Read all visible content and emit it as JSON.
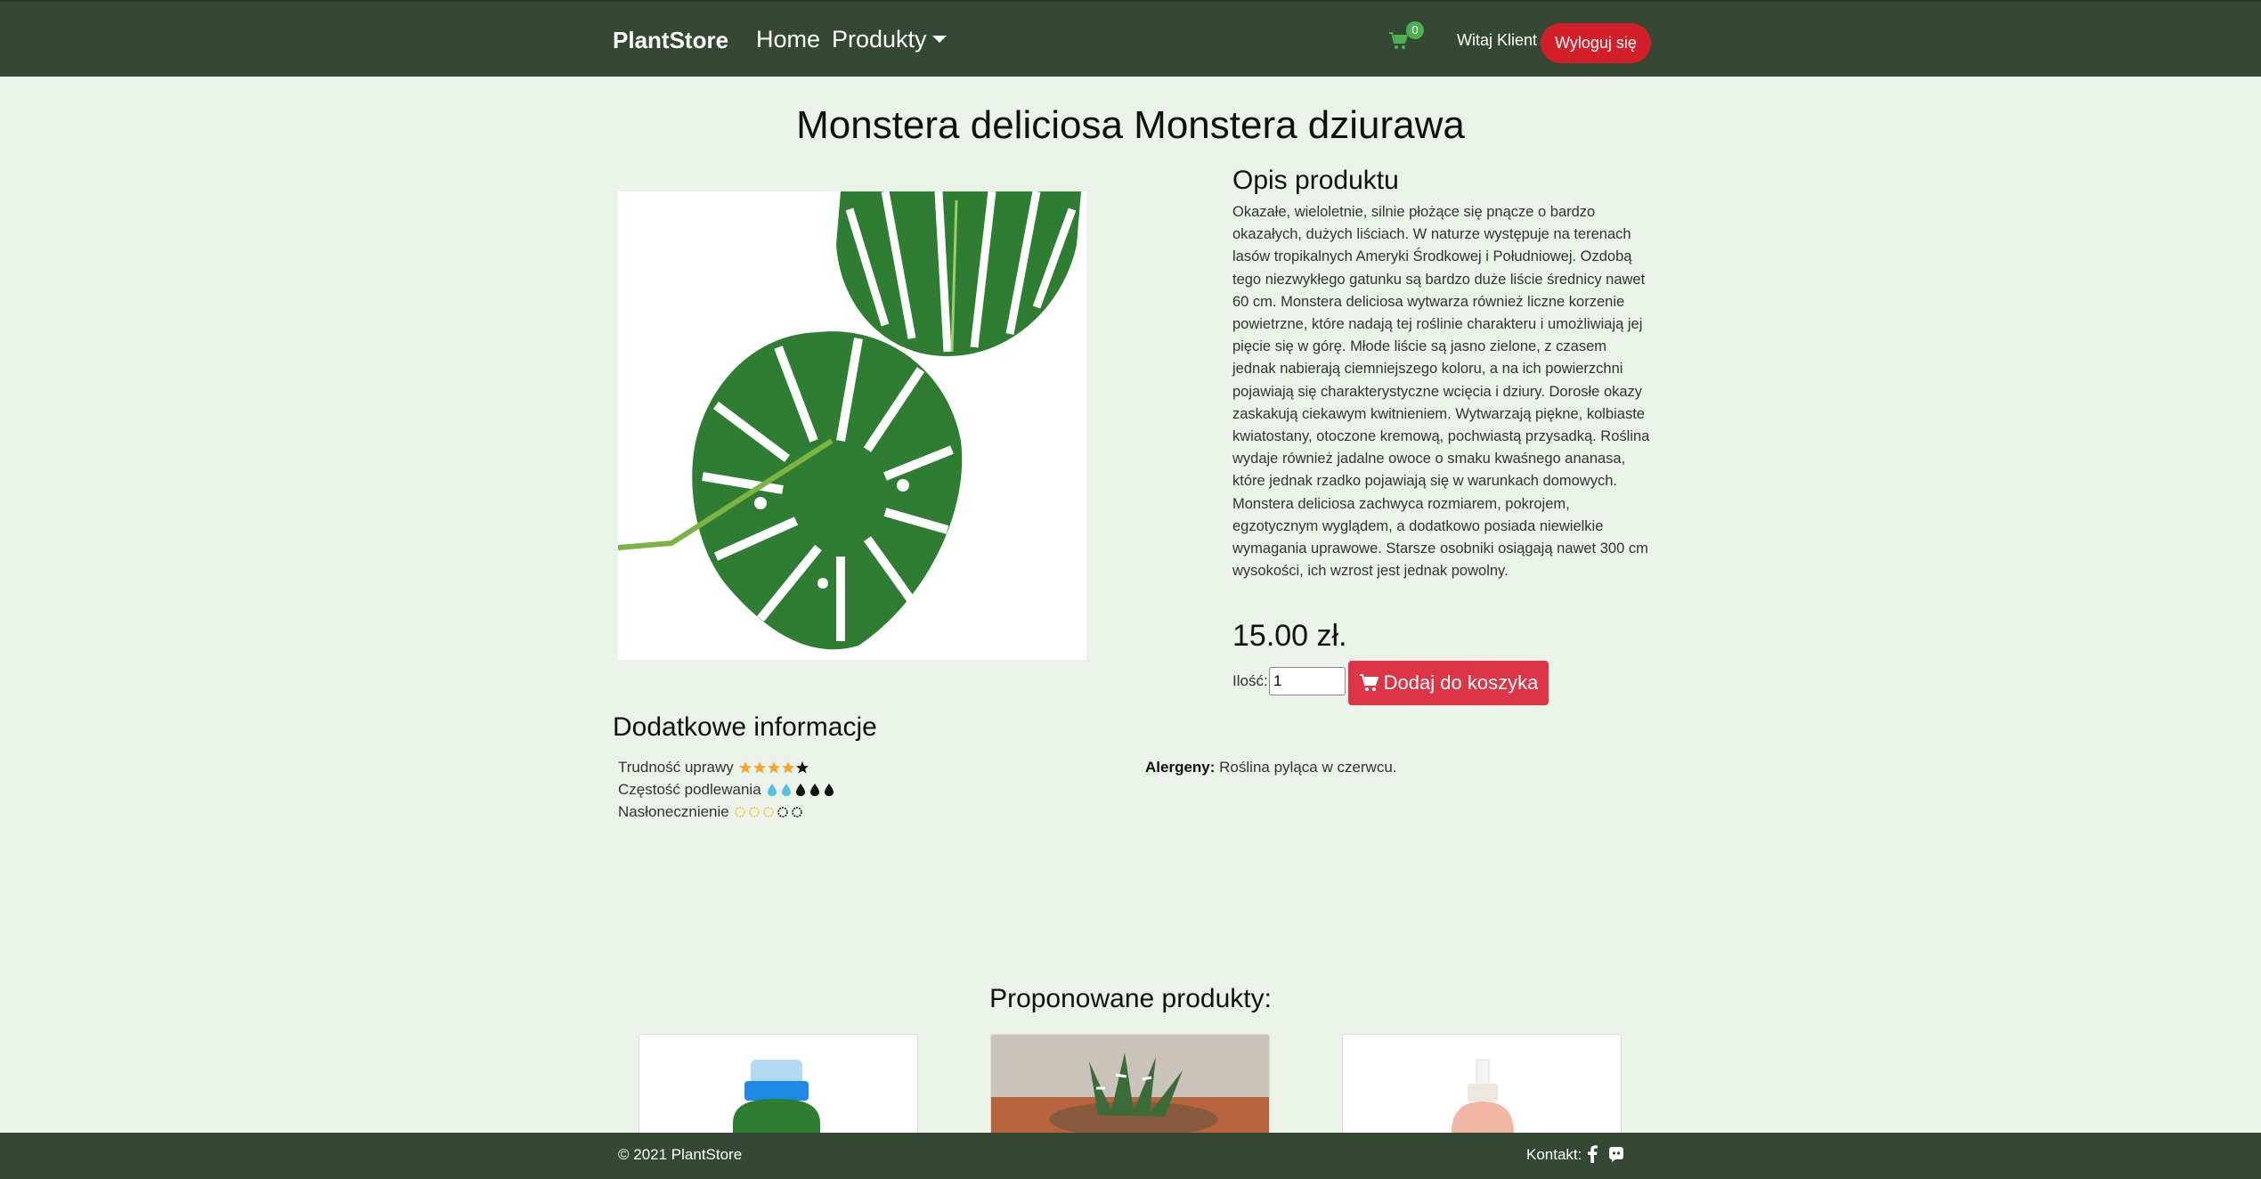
{
  "navbar": {
    "brand": "PlantStore",
    "home": "Home",
    "products": "Produkty",
    "cart_count": "0",
    "welcome": "Witaj Klient",
    "logout": "Wyloguj się"
  },
  "product": {
    "title": "Monstera deliciosa Monstera dziurawa",
    "description_title": "Opis produktu",
    "description": "Okazałe, wieloletnie, silnie płożące się pnącze o bardzo okazałych, dużych liściach. W naturze występuje na terenach lasów tropikalnych Ameryki Środkowej i Południowej. Ozdobą tego niezwykłego gatunku są bardzo duże liście średnicy nawet 60 cm. Monstera deliciosa wytwarza również liczne korzenie powietrzne, które nadają tej roślinie charakteru i umożliwiają jej pięcie się w górę. Młode liście są jasno zielone, z czasem jednak nabierają ciemniejszego koloru, a na ich powierzchni pojawiają się charakterystyczne wcięcia i dziury. Dorosłe okazy zaskakują ciekawym kwitnieniem. Wytwarzają piękne, kolbiaste kwiatostany, otoczone kremową, pochwiastą przysadką. Roślina wydaje również jadalne owoce o smaku kwaśnego ananasa, które jednak rzadko pojawiają się w warunkach domowych. Monstera deliciosa zachwyca rozmiarem, pokrojem, egzotycznym wyglądem, a dodatkowo posiada niewielkie wymagania uprawowe. Starsze osobniki osiągają nawet 300 cm wysokości, ich wzrost jest jednak powolny.",
    "price": "15.00 zł.",
    "qty_label": "Ilość:",
    "qty_value": "1",
    "add_to_cart": "Dodaj do koszyka"
  },
  "extra": {
    "title": "Dodatkowe informacje",
    "difficulty_label": "Trudność uprawy",
    "difficulty_level": 4,
    "watering_label": "Częstość podlewania",
    "watering_level": 2,
    "sun_label": "Nasłonecznienie",
    "sun_level": 3,
    "max_level": 5,
    "allergens_label": "Alergeny:",
    "allergens_value": "Roślina pyląca w czerwcu."
  },
  "suggested": {
    "title": "Proponowane produkty:"
  },
  "footer": {
    "copyright": "© 2021 PlantStore",
    "contact": "Kontakt:"
  },
  "colors": {
    "navbar": "#344834",
    "background": "#ebf2ea",
    "danger": "#dc3545",
    "logout": "#d21f2a",
    "badge": "#4caf50",
    "star": "#f5a623",
    "water": "#5bc0de",
    "sun": "#f0c419"
  }
}
